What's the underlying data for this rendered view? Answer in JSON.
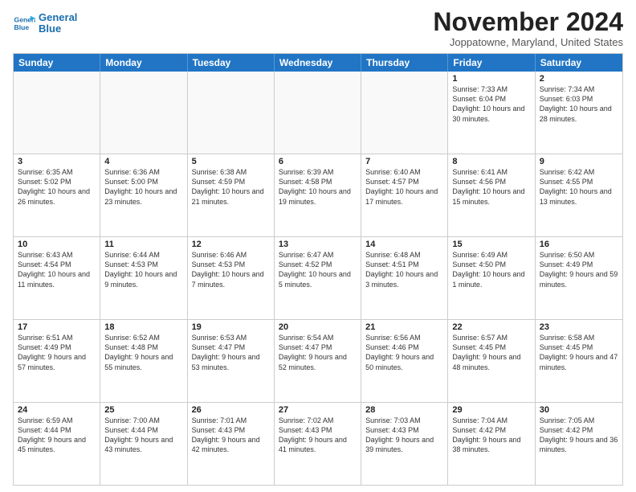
{
  "header": {
    "logo_line1": "General",
    "logo_line2": "Blue",
    "month_title": "November 2024",
    "location": "Joppatowne, Maryland, United States"
  },
  "days_of_week": [
    "Sunday",
    "Monday",
    "Tuesday",
    "Wednesday",
    "Thursday",
    "Friday",
    "Saturday"
  ],
  "rows": [
    [
      {
        "day": "",
        "empty": true
      },
      {
        "day": "",
        "empty": true
      },
      {
        "day": "",
        "empty": true
      },
      {
        "day": "",
        "empty": true
      },
      {
        "day": "",
        "empty": true
      },
      {
        "day": "1",
        "text": "Sunrise: 7:33 AM\nSunset: 6:04 PM\nDaylight: 10 hours and 30 minutes."
      },
      {
        "day": "2",
        "text": "Sunrise: 7:34 AM\nSunset: 6:03 PM\nDaylight: 10 hours and 28 minutes."
      }
    ],
    [
      {
        "day": "3",
        "text": "Sunrise: 6:35 AM\nSunset: 5:02 PM\nDaylight: 10 hours and 26 minutes."
      },
      {
        "day": "4",
        "text": "Sunrise: 6:36 AM\nSunset: 5:00 PM\nDaylight: 10 hours and 23 minutes."
      },
      {
        "day": "5",
        "text": "Sunrise: 6:38 AM\nSunset: 4:59 PM\nDaylight: 10 hours and 21 minutes."
      },
      {
        "day": "6",
        "text": "Sunrise: 6:39 AM\nSunset: 4:58 PM\nDaylight: 10 hours and 19 minutes."
      },
      {
        "day": "7",
        "text": "Sunrise: 6:40 AM\nSunset: 4:57 PM\nDaylight: 10 hours and 17 minutes."
      },
      {
        "day": "8",
        "text": "Sunrise: 6:41 AM\nSunset: 4:56 PM\nDaylight: 10 hours and 15 minutes."
      },
      {
        "day": "9",
        "text": "Sunrise: 6:42 AM\nSunset: 4:55 PM\nDaylight: 10 hours and 13 minutes."
      }
    ],
    [
      {
        "day": "10",
        "text": "Sunrise: 6:43 AM\nSunset: 4:54 PM\nDaylight: 10 hours and 11 minutes."
      },
      {
        "day": "11",
        "text": "Sunrise: 6:44 AM\nSunset: 4:53 PM\nDaylight: 10 hours and 9 minutes."
      },
      {
        "day": "12",
        "text": "Sunrise: 6:46 AM\nSunset: 4:53 PM\nDaylight: 10 hours and 7 minutes."
      },
      {
        "day": "13",
        "text": "Sunrise: 6:47 AM\nSunset: 4:52 PM\nDaylight: 10 hours and 5 minutes."
      },
      {
        "day": "14",
        "text": "Sunrise: 6:48 AM\nSunset: 4:51 PM\nDaylight: 10 hours and 3 minutes."
      },
      {
        "day": "15",
        "text": "Sunrise: 6:49 AM\nSunset: 4:50 PM\nDaylight: 10 hours and 1 minute."
      },
      {
        "day": "16",
        "text": "Sunrise: 6:50 AM\nSunset: 4:49 PM\nDaylight: 9 hours and 59 minutes."
      }
    ],
    [
      {
        "day": "17",
        "text": "Sunrise: 6:51 AM\nSunset: 4:49 PM\nDaylight: 9 hours and 57 minutes."
      },
      {
        "day": "18",
        "text": "Sunrise: 6:52 AM\nSunset: 4:48 PM\nDaylight: 9 hours and 55 minutes."
      },
      {
        "day": "19",
        "text": "Sunrise: 6:53 AM\nSunset: 4:47 PM\nDaylight: 9 hours and 53 minutes."
      },
      {
        "day": "20",
        "text": "Sunrise: 6:54 AM\nSunset: 4:47 PM\nDaylight: 9 hours and 52 minutes."
      },
      {
        "day": "21",
        "text": "Sunrise: 6:56 AM\nSunset: 4:46 PM\nDaylight: 9 hours and 50 minutes."
      },
      {
        "day": "22",
        "text": "Sunrise: 6:57 AM\nSunset: 4:45 PM\nDaylight: 9 hours and 48 minutes."
      },
      {
        "day": "23",
        "text": "Sunrise: 6:58 AM\nSunset: 4:45 PM\nDaylight: 9 hours and 47 minutes."
      }
    ],
    [
      {
        "day": "24",
        "text": "Sunrise: 6:59 AM\nSunset: 4:44 PM\nDaylight: 9 hours and 45 minutes."
      },
      {
        "day": "25",
        "text": "Sunrise: 7:00 AM\nSunset: 4:44 PM\nDaylight: 9 hours and 43 minutes."
      },
      {
        "day": "26",
        "text": "Sunrise: 7:01 AM\nSunset: 4:43 PM\nDaylight: 9 hours and 42 minutes."
      },
      {
        "day": "27",
        "text": "Sunrise: 7:02 AM\nSunset: 4:43 PM\nDaylight: 9 hours and 41 minutes."
      },
      {
        "day": "28",
        "text": "Sunrise: 7:03 AM\nSunset: 4:43 PM\nDaylight: 9 hours and 39 minutes."
      },
      {
        "day": "29",
        "text": "Sunrise: 7:04 AM\nSunset: 4:42 PM\nDaylight: 9 hours and 38 minutes."
      },
      {
        "day": "30",
        "text": "Sunrise: 7:05 AM\nSunset: 4:42 PM\nDaylight: 9 hours and 36 minutes."
      }
    ]
  ]
}
